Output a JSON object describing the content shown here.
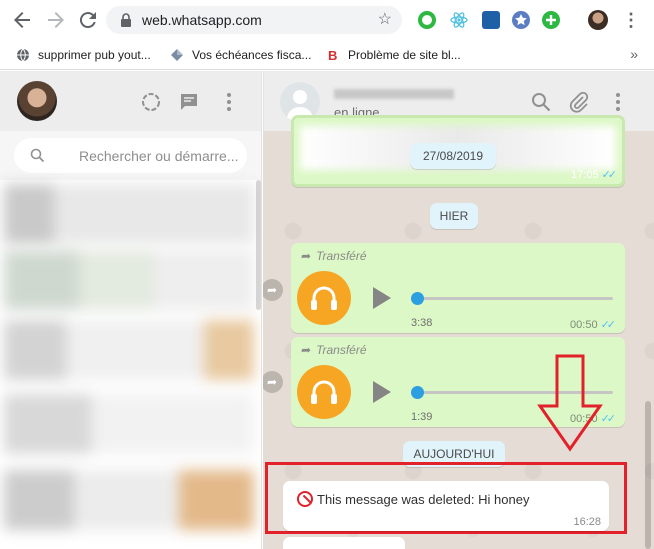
{
  "browser": {
    "url": "web.whatsapp.com",
    "bookmarks": [
      {
        "label": "supprimer pub yout...",
        "icon": "globe-icon"
      },
      {
        "label": "Vos échéances fisca...",
        "icon": "diamond-icon"
      },
      {
        "label": "Problème de site bl...",
        "icon": "blogger-b-icon"
      }
    ],
    "more_bookmarks": "»"
  },
  "sidebar": {
    "search_placeholder": "Rechercher ou démarre...",
    "chat_list_blurred": true
  },
  "chat": {
    "contact_status": "en ligne",
    "messages": {
      "top_time": "17:05",
      "date_1": "27/08/2019",
      "date_2": "HIER",
      "audio_1": {
        "forward_label": "Transféré",
        "duration": "3:38",
        "time": "00:50"
      },
      "audio_2": {
        "forward_label": "Transféré",
        "duration": "1:39",
        "time": "00:50"
      },
      "date_3": "AUJOURD'HUI",
      "deleted": {
        "text": "This message was deleted: Hi honey",
        "time": "16:28"
      }
    }
  },
  "colors": {
    "accent_red": "#e2212a",
    "outgoing_bubble": "#dcf8c6",
    "audio_orange": "#f6a623",
    "read_ticks": "#4fc3f7"
  }
}
